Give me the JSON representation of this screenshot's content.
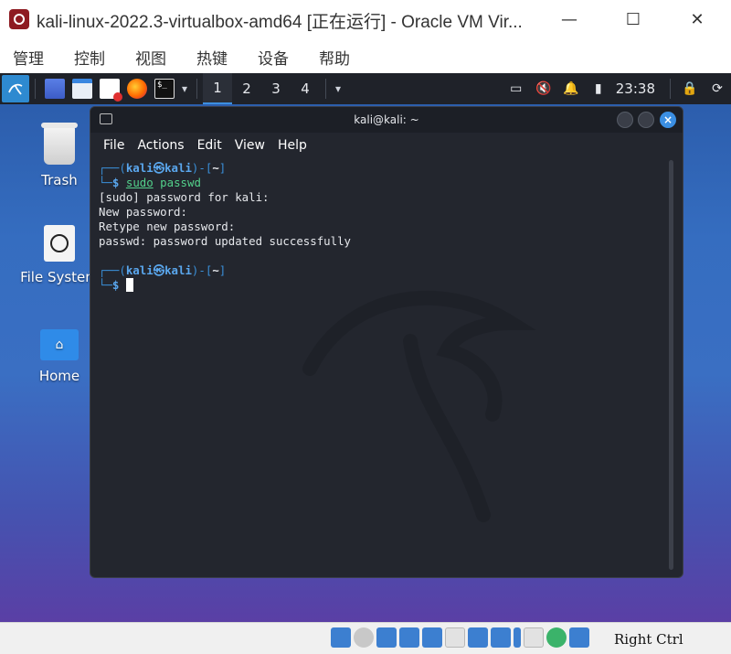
{
  "window": {
    "title": "kali-linux-2022.3-virtualbox-amd64 [正在运行] - Oracle VM Vir...",
    "controls": {
      "minimize": "—",
      "maximize": "☐",
      "close": "✕"
    }
  },
  "host_menu": [
    "管理",
    "控制",
    "视图",
    "热键",
    "设备",
    "帮助"
  ],
  "panel": {
    "workspaces": [
      "1",
      "2",
      "3",
      "4"
    ],
    "active_workspace": "1",
    "clock": "23:38"
  },
  "desktop_icons": {
    "trash": "Trash",
    "filesystem": "File System",
    "home": "Home"
  },
  "terminal": {
    "title": "kali@kali: ~",
    "menu": [
      "File",
      "Actions",
      "Edit",
      "View",
      "Help"
    ],
    "prompt": {
      "user": "kali",
      "at": "㉿",
      "host": "kali",
      "dir": "~",
      "symbol": "$"
    },
    "command_name": "sudo",
    "command_args": "passwd",
    "output": [
      "[sudo] password for kali:",
      "New password:",
      "Retype new password:",
      "passwd: password updated successfully"
    ]
  },
  "statusbar": {
    "host_key": "Right Ctrl"
  },
  "colors": {
    "accent": "#3b8fe3",
    "prompt_blue": "#5aa7ee",
    "command_green": "#53d18b",
    "terminal_bg": "#23262e",
    "panel_bg": "#1f2229"
  }
}
